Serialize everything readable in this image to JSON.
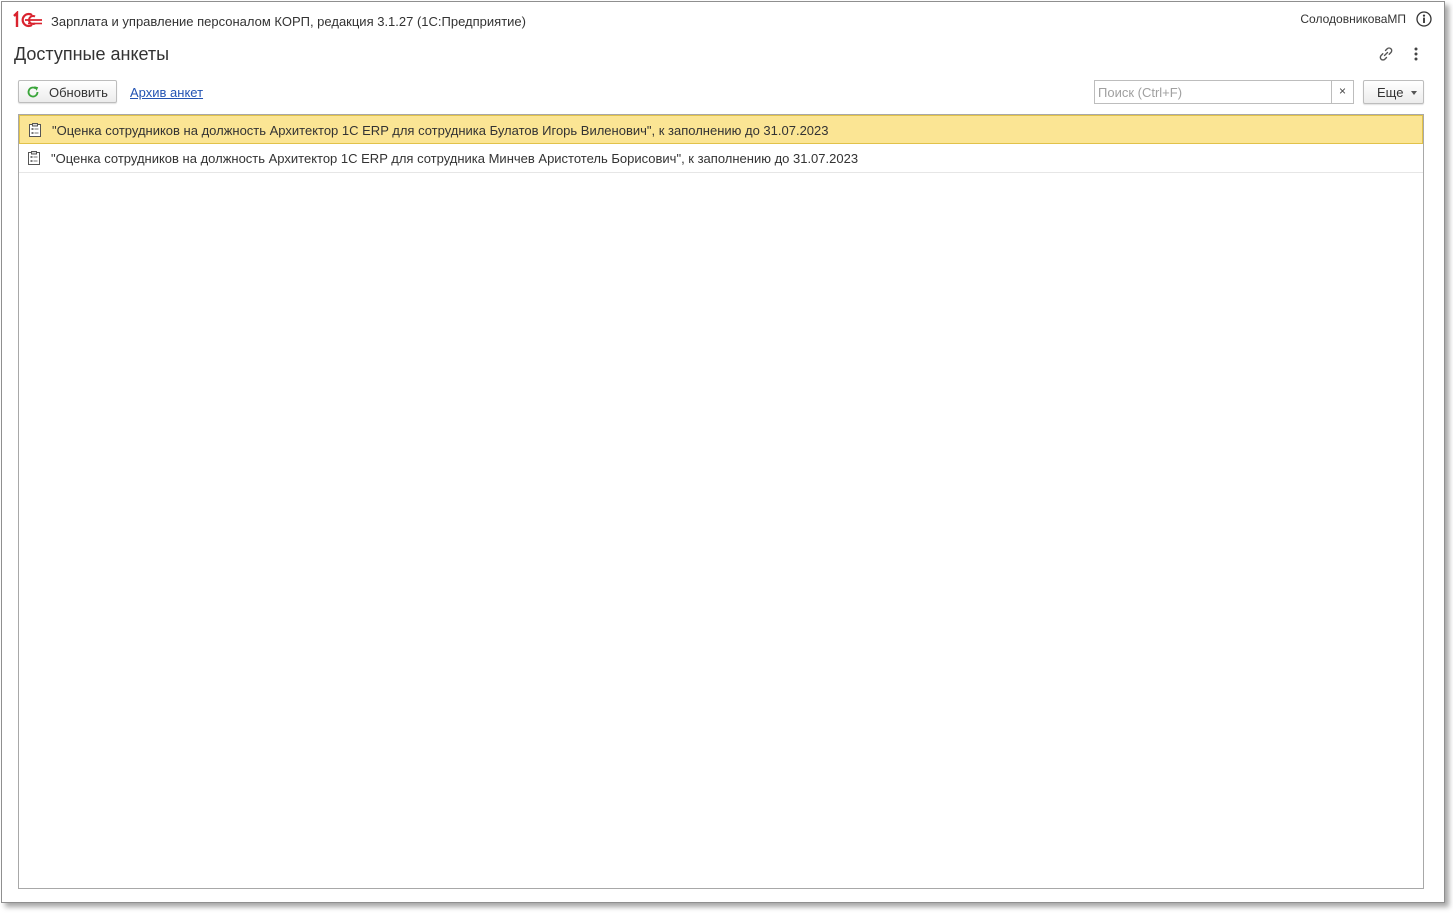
{
  "titlebar": {
    "app_title": "Зарплата и управление персоналом КОРП, редакция 3.1.27  (1С:Предприятие)",
    "user_name": "СолодовниковаМП"
  },
  "page": {
    "title": "Доступные анкеты"
  },
  "toolbar": {
    "refresh_label": "Обновить",
    "archive_link": "Архив анкет",
    "search_placeholder": "Поиск (Ctrl+F)",
    "search_value": "",
    "search_clear": "×",
    "more_label": "Еще"
  },
  "list": {
    "items": [
      {
        "text": "\"Оценка сотрудников на должность Архитектор 1С ERP для сотрудника Булатов Игорь Виленович\", к заполнению до 31.07.2023",
        "selected": true
      },
      {
        "text": "\"Оценка сотрудников на должность Архитектор 1С ERP для сотрудника Минчев Аристотель Борисович\", к заполнению до 31.07.2023",
        "selected": false
      }
    ]
  },
  "colors": {
    "selection_bg": "#fbe594",
    "link": "#2253b3",
    "logo_red": "#d9232e",
    "refresh_green": "#3aa53a"
  }
}
